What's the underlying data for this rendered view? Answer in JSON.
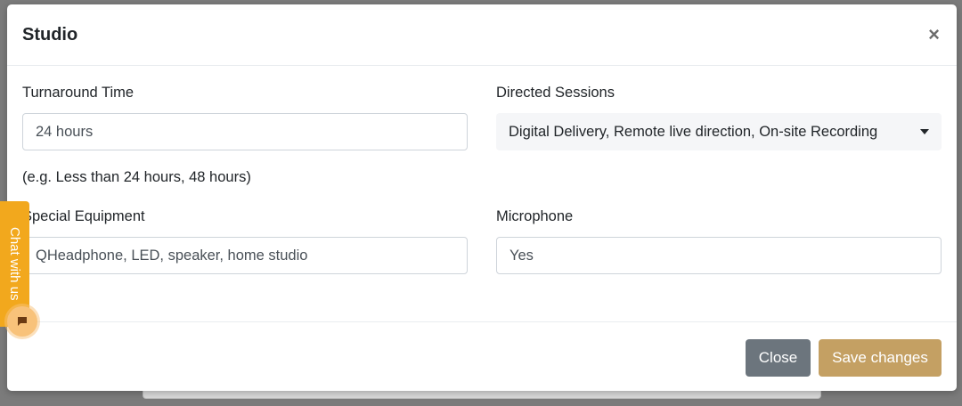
{
  "modal": {
    "title": "Studio",
    "close_icon": "×"
  },
  "form": {
    "turnaround": {
      "label": "Turnaround Time",
      "value": "24 hours",
      "help": "(e.g. Less than 24 hours, 48 hours)"
    },
    "directed_sessions": {
      "label": "Directed Sessions",
      "value": "Digital Delivery, Remote live direction, On-site Recording"
    },
    "special_equipment": {
      "label": "Special Equipment",
      "value": "QHeadphone, LED, speaker, home studio"
    },
    "microphone": {
      "label": "Microphone",
      "value": "Yes"
    }
  },
  "footer": {
    "close_label": "Close",
    "save_label": "Save changes"
  },
  "chat": {
    "label": "Chat with us",
    "icon": "chat-bubble-icon"
  },
  "colors": {
    "overlay": "#7b7b7b",
    "save_button": "#c4a063",
    "close_button": "#6c757d",
    "chat_tab": "#f2a81d"
  }
}
